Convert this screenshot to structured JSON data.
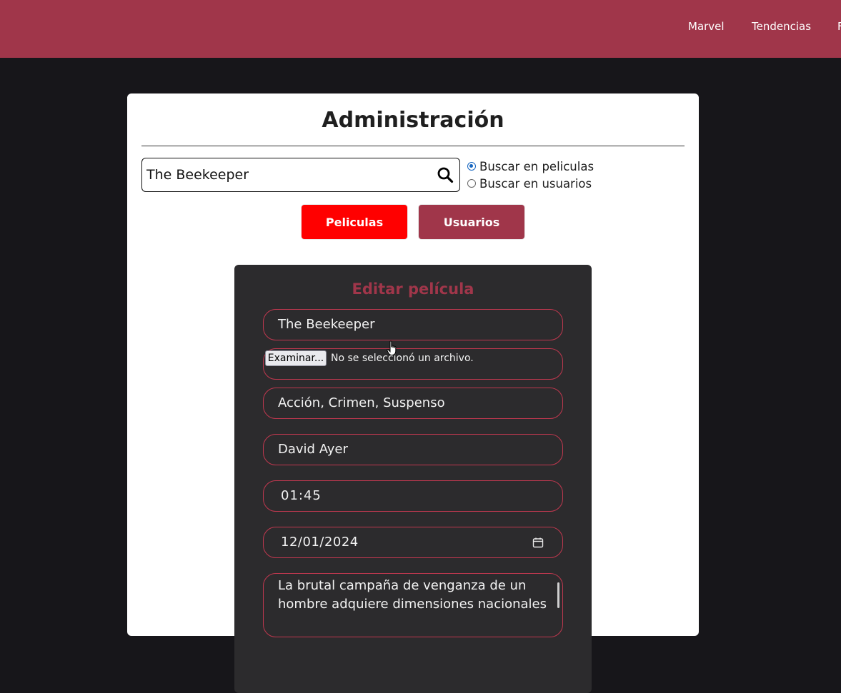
{
  "nav": {
    "links": [
      "Marvel",
      "Tendencias",
      "F"
    ]
  },
  "admin": {
    "title": "Administración",
    "search": {
      "value": "The Beekeeper",
      "icon": "search-icon"
    },
    "radios": [
      {
        "label": "Buscar en peliculas",
        "checked": true
      },
      {
        "label": "Buscar en usuarios",
        "checked": false
      }
    ],
    "tabs": [
      {
        "label": "Peliculas",
        "color": "#ff0000"
      },
      {
        "label": "Usuarios",
        "color": "#a0364a"
      }
    ]
  },
  "edit_form": {
    "title": "Editar película",
    "title_color": "#a0364a",
    "field_border_color": "#c0384f",
    "name": "The Beekeeper",
    "file_button": "Examinar...",
    "file_status": "No se seleccionó un archivo.",
    "genres": "Acción, Crimen, Suspenso",
    "director": "David Ayer",
    "duration": "01:45",
    "release_date": "12/01/2024",
    "description": "La brutal campaña de venganza de un hombre adquiere dimensiones nacionales"
  },
  "colors": {
    "topbar": "#a0364a",
    "background": "#17161a",
    "panel": "#ffffff",
    "card": "#2c2b2d"
  }
}
